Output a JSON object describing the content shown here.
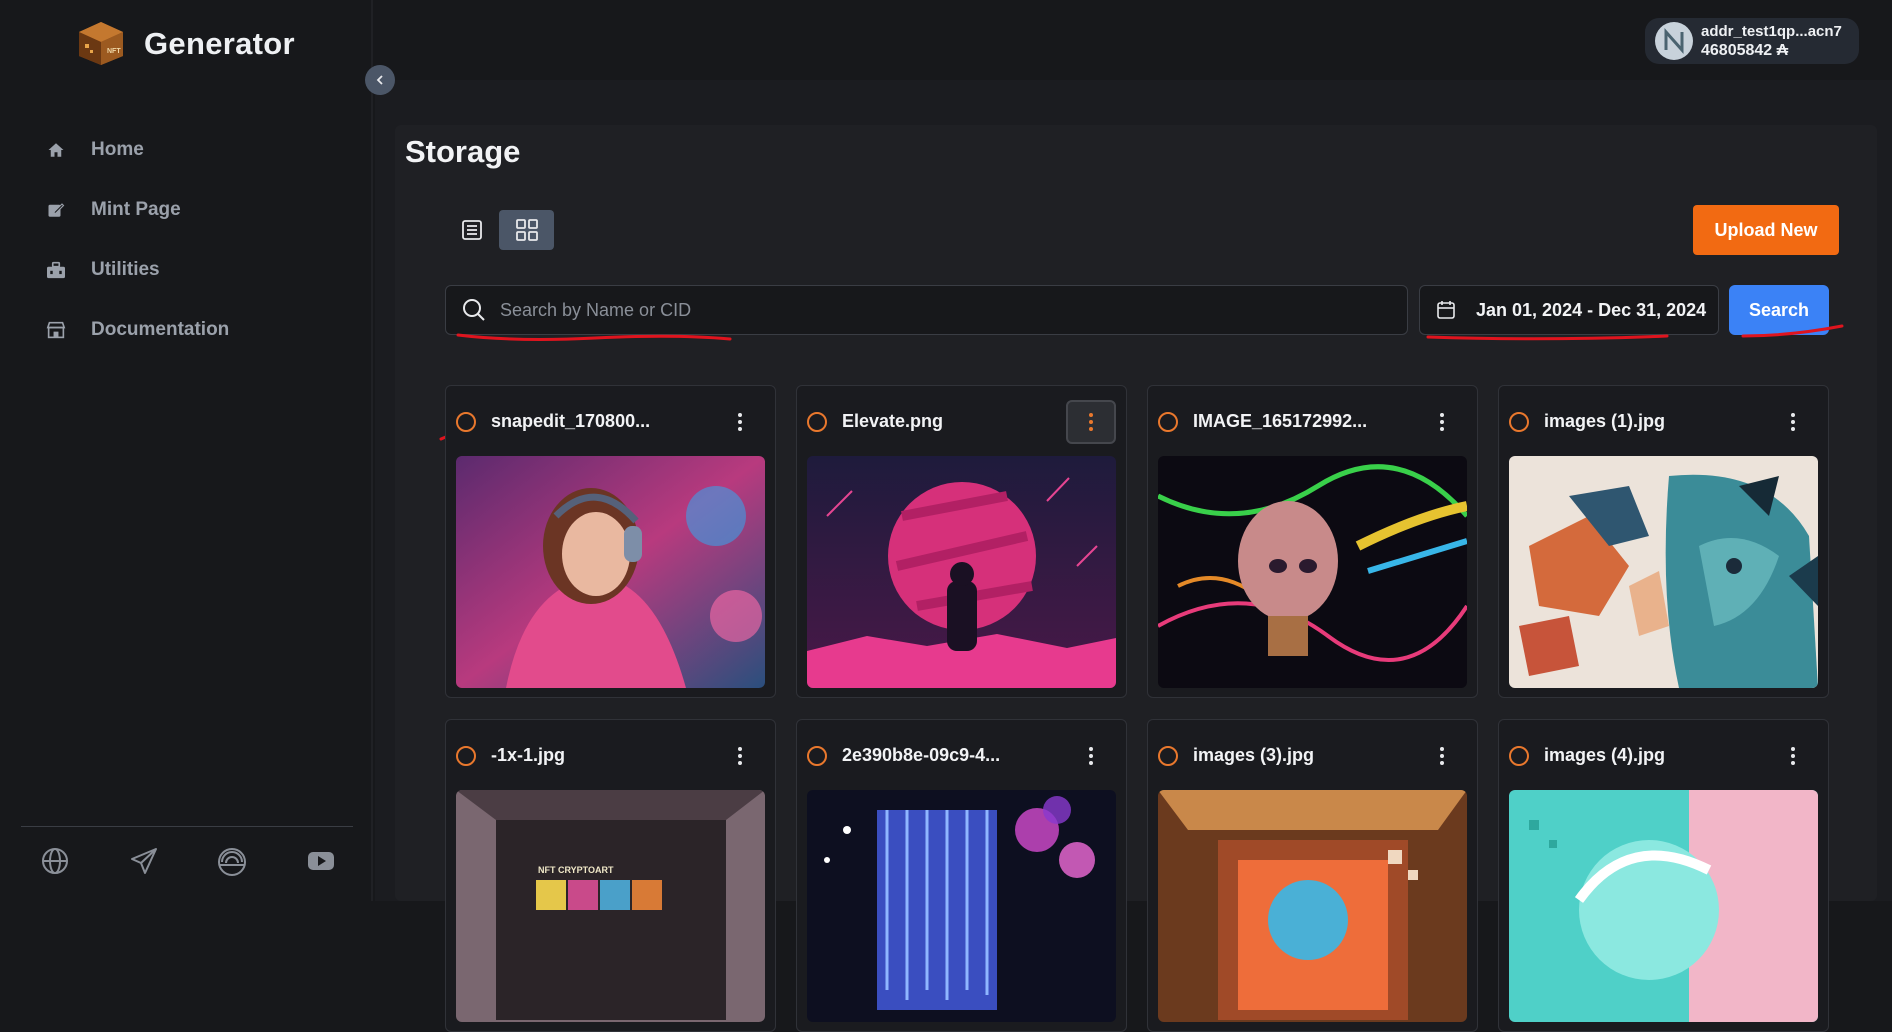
{
  "app": {
    "brand": "Generator"
  },
  "sidebar": {
    "items": [
      {
        "label": "Home",
        "icon": "home-icon"
      },
      {
        "label": "Mint Page",
        "icon": "edit-icon"
      },
      {
        "label": "Utilities",
        "icon": "toolbox-icon"
      },
      {
        "label": "Documentation",
        "icon": "store-icon"
      }
    ],
    "socials": [
      "globe-icon",
      "telegram-icon",
      "rainbow-icon",
      "youtube-icon"
    ]
  },
  "wallet": {
    "address": "addr_test1qp...acn7",
    "balance": "46805842 ₳"
  },
  "page": {
    "title": "Storage"
  },
  "toolbar": {
    "upload_label": "Upload New",
    "search_label": "Search"
  },
  "search": {
    "placeholder": "Search by Name or CID",
    "value": ""
  },
  "date_range": {
    "label": "Jan 01, 2024 - Dec 31, 2024"
  },
  "files": [
    {
      "name": "snapedit_170800..."
    },
    {
      "name": "Elevate.png"
    },
    {
      "name": "IMAGE_165172992..."
    },
    {
      "name": "images (1).jpg"
    },
    {
      "name": "-1x-1.jpg"
    },
    {
      "name": "2e390b8e-09c9-4..."
    },
    {
      "name": "images (3).jpg"
    },
    {
      "name": "images (4).jpg"
    }
  ],
  "thumb_text": {
    "cryptoart": "NFT CRYPTOART"
  },
  "colors": {
    "accent": "#f26a12",
    "primary": "#3b82f6",
    "annotation": "#e0141e"
  }
}
